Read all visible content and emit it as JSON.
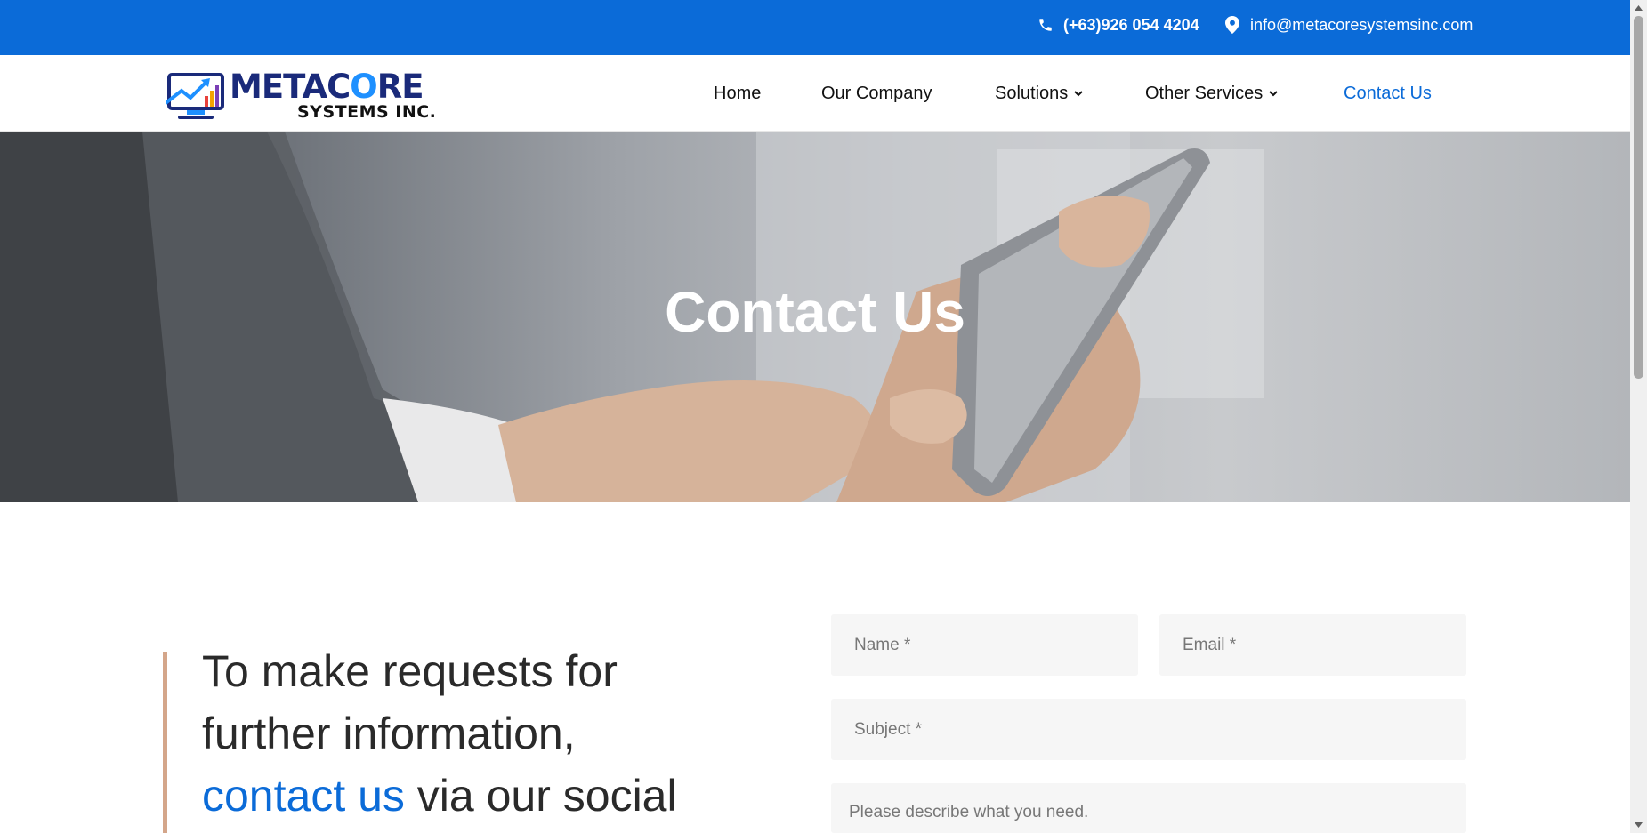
{
  "topbar": {
    "phone": "(+63)926 054 4204",
    "email": "info@metacoresystemsinc.com",
    "phone_icon": "phone-icon",
    "email_icon": "map-marker-icon"
  },
  "logo": {
    "main_prefix": "METAC",
    "main_accent": "O",
    "main_suffix": "RE",
    "sub": "SYSTEMS INC."
  },
  "nav": {
    "items": [
      {
        "label": "Home"
      },
      {
        "label": "Our Company"
      },
      {
        "label": "Solutions"
      },
      {
        "label": "Other Services"
      },
      {
        "label": "Contact Us"
      }
    ]
  },
  "hero": {
    "title": "Contact Us"
  },
  "intro": {
    "line1": "To make requests for",
    "line2": "further information,",
    "link": "contact us",
    "line3_rest": " via our social"
  },
  "form": {
    "name_placeholder": "Name *",
    "email_placeholder": "Email *",
    "subject_placeholder": "Subject *",
    "message_placeholder": "Please describe what you need."
  },
  "colors": {
    "brand_blue": "#0b6bd8",
    "accent_bar": "#d4a68a"
  }
}
